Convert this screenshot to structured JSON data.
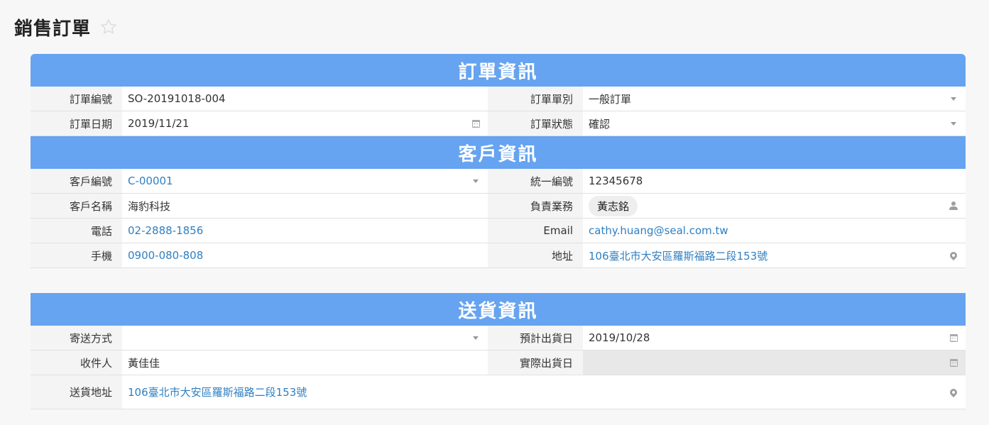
{
  "page": {
    "title": "銷售訂單"
  },
  "sections": {
    "order": {
      "title": "訂單資訊"
    },
    "customer": {
      "title": "客戶資訊"
    },
    "delivery": {
      "title": "送貨資訊"
    }
  },
  "order": {
    "order_no": {
      "label": "訂單編號",
      "value": "SO-20191018-004"
    },
    "order_type": {
      "label": "訂單單別",
      "value": "一般訂單"
    },
    "order_date": {
      "label": "訂單日期",
      "value": "2019/11/21"
    },
    "order_status": {
      "label": "訂單狀態",
      "value": "確認"
    }
  },
  "customer": {
    "customer_no": {
      "label": "客戶編號",
      "value": "C-00001"
    },
    "tax_id": {
      "label": "統一編號",
      "value": "12345678"
    },
    "customer_name": {
      "label": "客戶名稱",
      "value": "海豹科技"
    },
    "sales_rep": {
      "label": "負責業務",
      "value": "黃志銘"
    },
    "phone": {
      "label": "電話",
      "value": "02-2888-1856"
    },
    "email": {
      "label": "Email",
      "value": "cathy.huang@seal.com.tw"
    },
    "mobile": {
      "label": "手機",
      "value": "0900-080-808"
    },
    "address": {
      "label": "地址",
      "value": "106臺北市大安區羅斯福路二段153號"
    }
  },
  "delivery": {
    "method": {
      "label": "寄送方式",
      "value": ""
    },
    "planned_ship_date": {
      "label": "預計出貨日",
      "value": "2019/10/28"
    },
    "recipient": {
      "label": "收件人",
      "value": "黃佳佳"
    },
    "actual_ship_date": {
      "label": "實際出貨日",
      "value": ""
    },
    "address": {
      "label": "送貨地址",
      "value": "106臺北市大安區羅斯福路二段153號"
    }
  },
  "icons": {
    "favorite": "star-outline-icon",
    "dropdown": "caret-down-icon",
    "date": "calendar-icon",
    "user": "person-icon",
    "location": "map-pin-icon"
  },
  "colors": {
    "section_header": "#66a3f0",
    "link": "#2f7fc1",
    "label_bg": "#f4f4f4"
  }
}
